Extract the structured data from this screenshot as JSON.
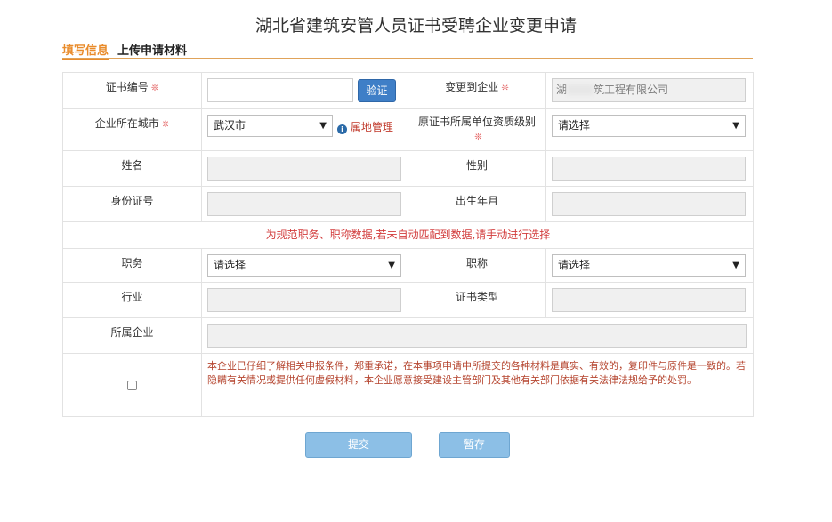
{
  "page": {
    "title": "湖北省建筑安管人员证书受聘企业变更申请"
  },
  "tabs": [
    {
      "label": "填写信息"
    },
    {
      "label": "上传申请材料"
    }
  ],
  "form": {
    "cert_no_label": "证书编号",
    "verify_label": "验证",
    "target_company_label": "变更到企业",
    "target_company_prefix": "湖",
    "target_company_suffix": "筑工程有限公司",
    "city_label": "企业所在城市",
    "city_value": "武汉市",
    "city_link": "属地管理",
    "orig_level_label": "原证书所属单位资质级别",
    "orig_level_value": "请选择",
    "name_label": "姓名",
    "gender_label": "性别",
    "id_label": "身份证号",
    "birth_label": "出生年月",
    "notice": "为规范职务、职称数据,若未自动匹配到数据,请手动进行选择",
    "position_label": "职务",
    "position_value": "请选择",
    "title_label": "职称",
    "title_value": "请选择",
    "industry_label": "行业",
    "cert_type_label": "证书类型",
    "company_label": "所属企业",
    "agreement": "本企业已仔细了解相关申报条件，郑重承诺，在本事项申请中所提交的各种材料是真实、有效的，复印件与原件是一致的。若隐瞒有关情况或提供任何虚假材料，本企业愿意接受建设主管部门及其他有关部门依据有关法律法规给予的处罚。",
    "required_mark": "❊"
  },
  "actions": {
    "submit": "提交",
    "save": "暂存"
  },
  "colors": {
    "accent": "#e98b2a",
    "notice": "#d23b3b",
    "button": "#8cbfe6",
    "verify": "#3f7fc7"
  }
}
